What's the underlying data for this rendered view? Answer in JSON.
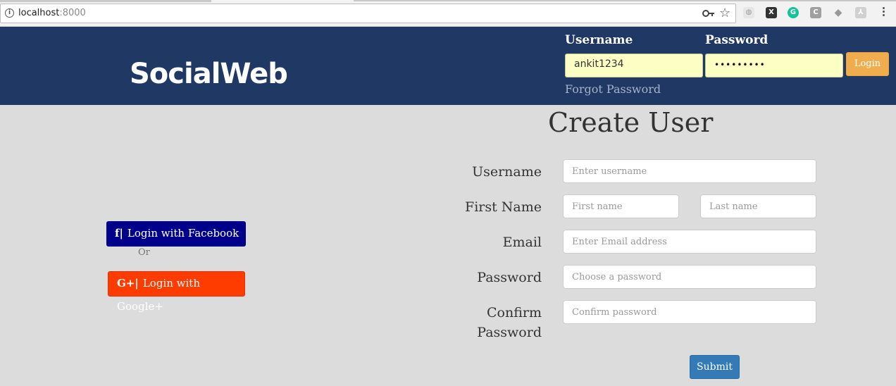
{
  "browser": {
    "url_host": "localhost",
    "url_port": ":8000",
    "extensions": [
      {
        "name": "ext-1",
        "glyph": "◍",
        "color": "#ccc"
      },
      {
        "name": "ext-x",
        "glyph": "X",
        "color": "#444"
      },
      {
        "name": "grammarly",
        "glyph": "G",
        "color": "#15c39a"
      },
      {
        "name": "ext-c",
        "glyph": "C",
        "color": "#999"
      },
      {
        "name": "ext-diamond",
        "glyph": "◆",
        "color": "#aaa"
      },
      {
        "name": "ext-pdf",
        "glyph": "⅄",
        "color": "#bbb"
      }
    ]
  },
  "navbar": {
    "brand": "SocialWeb",
    "username_label": "Username",
    "password_label": "Password",
    "username_value": "ankit1234",
    "password_value": "•••••••••",
    "login_label": "Login",
    "forgot_label": "Forgot Password",
    "bg_color": "#203864",
    "login_color": "#f0ad4e"
  },
  "social": {
    "facebook_icon": "f|",
    "facebook_label": "Login with Facebook",
    "or_label": "Or",
    "google_icon": "G+|",
    "google_label": "Login with Google+"
  },
  "form": {
    "title": "Create User",
    "username_label": "Username",
    "username_placeholder": "Enter username",
    "firstname_label": "First Name",
    "firstname_placeholder": "First name",
    "lastname_placeholder": "Last name",
    "email_label": "Email",
    "email_placeholder": "Enter Email address",
    "password_label": "Password",
    "password_placeholder": "Choose a password",
    "confirm_label_1": "Confirm",
    "confirm_label_2": "Password",
    "confirm_placeholder": "Confirm password",
    "submit_label": "Submit"
  }
}
